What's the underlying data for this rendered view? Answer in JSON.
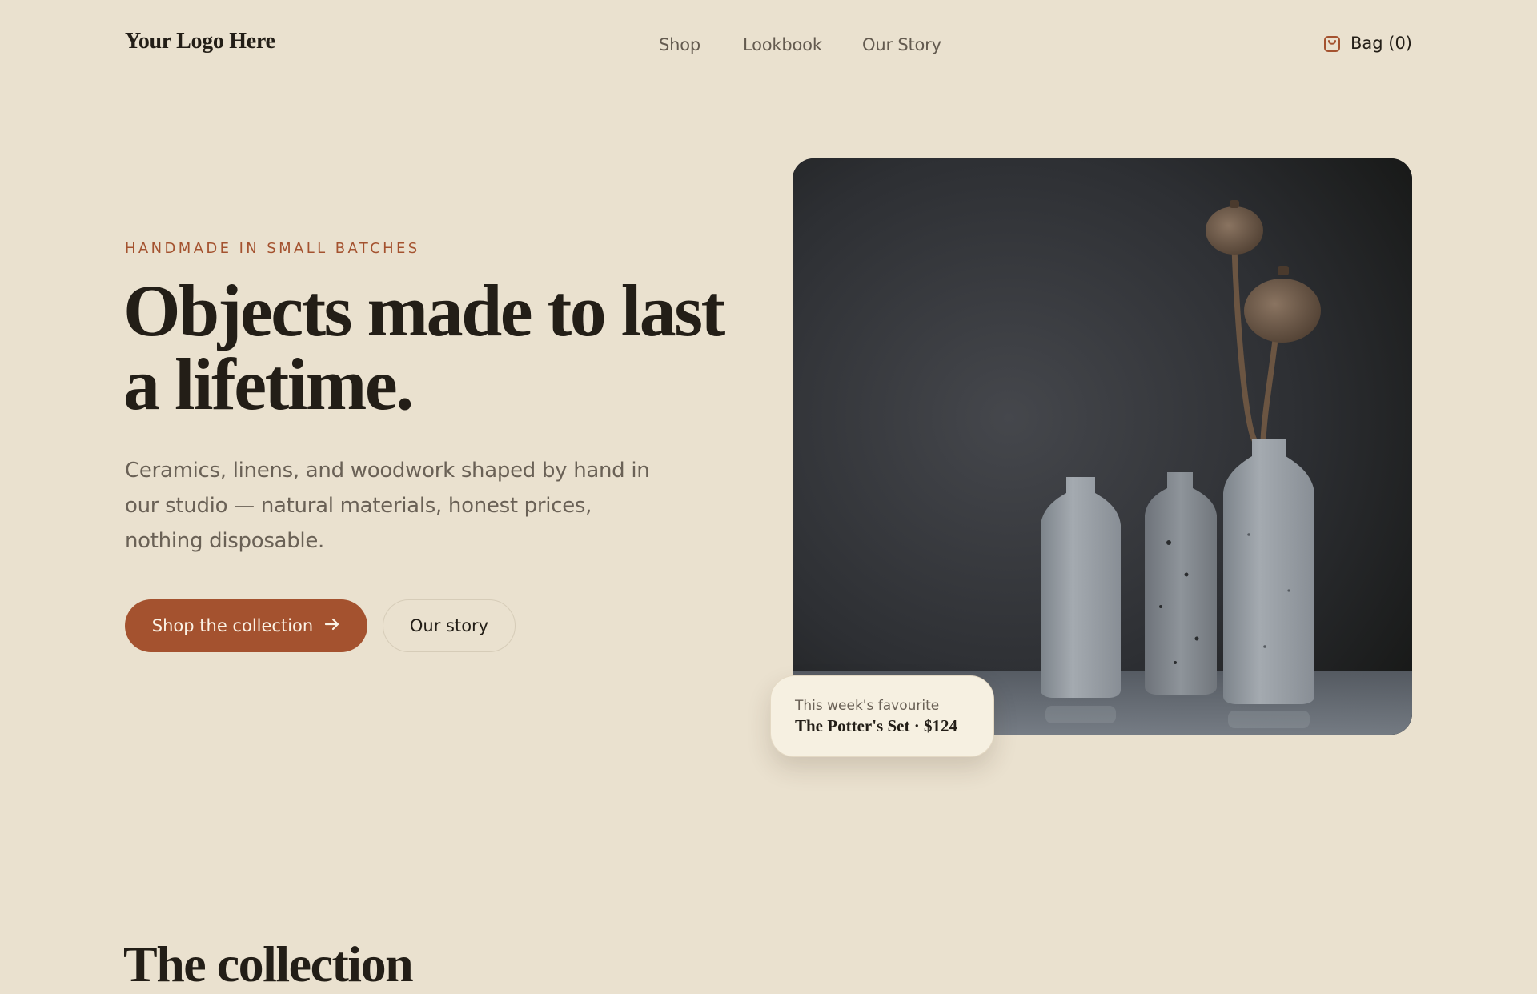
{
  "header": {
    "logo": "Your Logo Here",
    "nav": [
      {
        "label": "Shop"
      },
      {
        "label": "Lookbook"
      },
      {
        "label": "Our Story"
      }
    ],
    "bag_label": "Bag (0)",
    "bag_icon": "shopping-bag-icon"
  },
  "hero": {
    "eyebrow": "HANDMADE IN SMALL BATCHES",
    "headline": "Objects made to last a lifetime.",
    "description": "Ceramics, linens, and woodwork shaped by hand in our studio — natural materials, honest prices, nothing disposable.",
    "primary_button": {
      "label": "Shop the collection",
      "icon": "arrow-right-icon"
    },
    "secondary_button": {
      "label": "Our story"
    },
    "featured": {
      "label": "This week's favourite",
      "title": "The Potter's Set · $124"
    }
  },
  "collection": {
    "title": "The collection"
  },
  "colors": {
    "background": "#EAE1CF",
    "accent": "#A4522F",
    "text": "#231E17",
    "muted": "#6A6156",
    "card": "#F6F0E1"
  }
}
